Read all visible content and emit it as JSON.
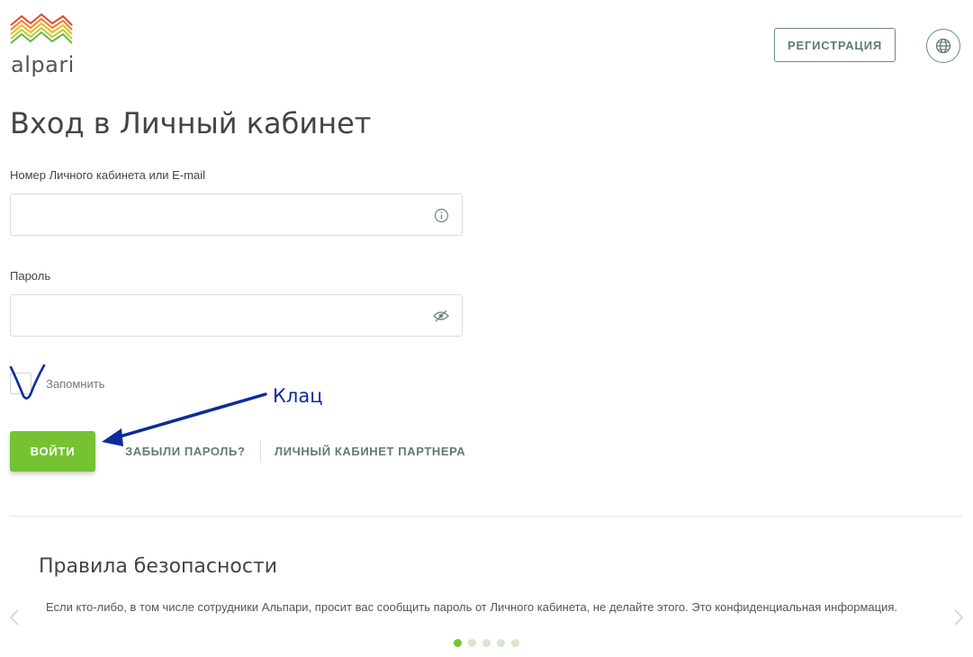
{
  "brand": {
    "name": "alpari"
  },
  "header": {
    "register_label": "РЕГИСТРАЦИЯ",
    "language_icon": "globe-icon"
  },
  "page": {
    "title": "Вход в Личный кабинет"
  },
  "form": {
    "login_label": "Номер Личного кабинета или E-mail",
    "login_value": "",
    "login_placeholder": "",
    "login_icon": "info-icon",
    "password_label": "Пароль",
    "password_value": "",
    "password_placeholder": "",
    "password_icon": "eye-hidden-icon",
    "remember_label": "Запомнить",
    "remember_checked": true,
    "submit_label": "ВОЙТИ",
    "forgot_label": "ЗАБЫЛИ ПАРОЛЬ?",
    "partner_label": "ЛИЧНЫЙ КАБИНЕТ ПАРТНЕРА"
  },
  "annotation": {
    "text": "Клац"
  },
  "security": {
    "title": "Правила безопасности",
    "text": "Если кто-либо, в том числе сотрудники Альпари, просит вас сообщить пароль от Личного кабинета, не делайте этого. Это конфиденциальная информация.",
    "slides_total": 5,
    "active_slide": 1
  },
  "colors": {
    "accent_green": "#76c331",
    "link_teal": "#5e7b79",
    "annotation_blue": "#0f2a9c"
  }
}
